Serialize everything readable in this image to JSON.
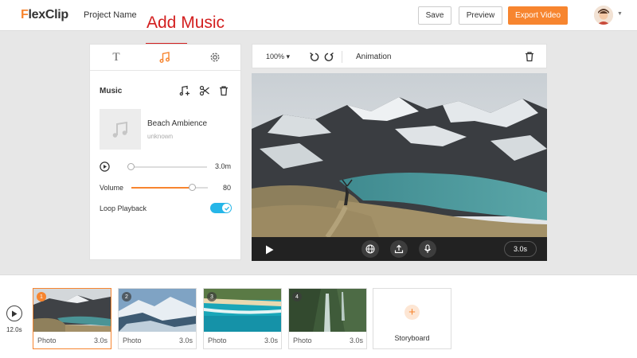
{
  "topbar": {
    "logo_f": "F",
    "logo_rest": "lexClip",
    "project_name": "Project Name",
    "save": "Save",
    "preview": "Preview",
    "export": "Export Video"
  },
  "annotation": {
    "text": "Add Music"
  },
  "panel": {
    "tabs": [
      "text",
      "music",
      "settings"
    ],
    "active_tab": "music",
    "text_tab_glyph": "T",
    "section_title": "Music",
    "track": {
      "name": "Beach Ambience",
      "artist": "unknown"
    },
    "duration": "3.0m",
    "volume_label": "Volume",
    "volume_value": "80",
    "volume_level": 0.8,
    "loop_label": "Loop Playback",
    "loop_on": true
  },
  "editor": {
    "zoom": "100% ▾",
    "animation_label": "Animation",
    "duration_pill": "3.0s"
  },
  "storyboard": {
    "total_time": "12.0s",
    "clips": [
      {
        "num": "1",
        "type": "Photo",
        "dur": "3.0s"
      },
      {
        "num": "2",
        "type": "Photo",
        "dur": "3.0s"
      },
      {
        "num": "3",
        "type": "Photo",
        "dur": "3.0s"
      },
      {
        "num": "4",
        "type": "Photo",
        "dur": "3.0s"
      }
    ],
    "add_label": "Storyboard",
    "add_glyph": "+"
  },
  "colors": {
    "accent": "#f7852f",
    "toggle": "#26b6e8",
    "annotation": "#d32020"
  }
}
